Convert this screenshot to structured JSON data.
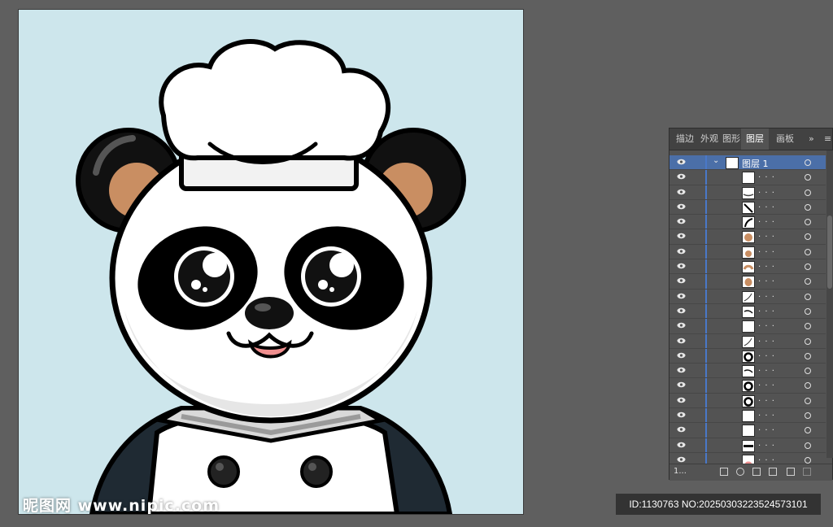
{
  "watermark": {
    "text": "昵图网 www.nipic.com"
  },
  "image_id": {
    "text": "ID:1130763 NO:20250303223524573101"
  },
  "layers_panel": {
    "tabs": [
      {
        "label": "描边",
        "active": false
      },
      {
        "label": "外观",
        "active": false
      },
      {
        "label": "图形",
        "active": false
      },
      {
        "label": "图层",
        "active": true
      },
      {
        "label": "画板",
        "active": false
      }
    ],
    "overflow_icon": "double-chevron-right-icon",
    "menu_icon": "panel-menu-icon",
    "layer_name": "图层 1",
    "item_placeholder": ". . .",
    "sublayer_thumbs": [
      "white-shape",
      "stroke-curve",
      "diagonal-line",
      "curve-line",
      "brown-ear",
      "brown-ear-small",
      "brown-ear-2",
      "brown-ear-small-2",
      "line-arc",
      "dark-arc",
      "white-shape",
      "line-arc",
      "black-ring",
      "dark-arc",
      "black-ring",
      "black-ring",
      "white-shape",
      "white-shape",
      "dark-band",
      "pink-shape"
    ],
    "footer_count": "1...",
    "colors": {
      "panel_bg": "#535353",
      "selected_row": "#4b6fa8",
      "layer_color_bar": "#4a78c8"
    }
  },
  "artboard": {
    "background_color": "#cde6ec",
    "subject": "panda-chef"
  }
}
